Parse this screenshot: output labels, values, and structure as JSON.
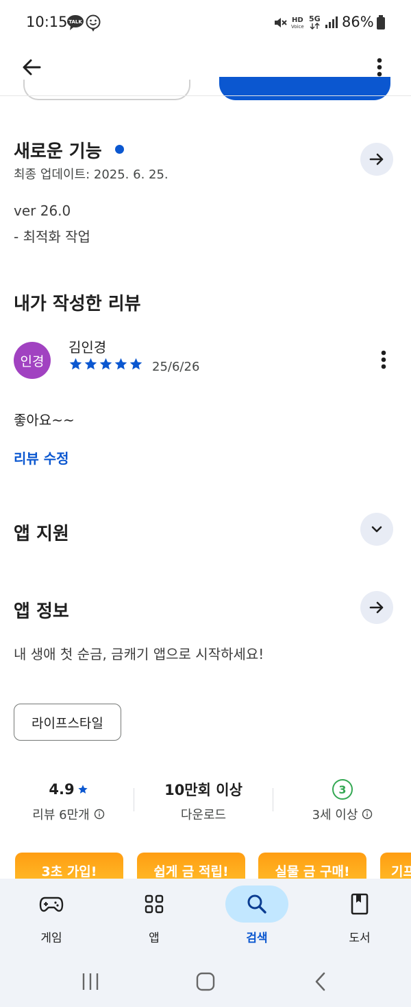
{
  "status_bar": {
    "time": "10:15",
    "notification_icons": [
      "talk-icon",
      "smile-icon"
    ],
    "system_icons": [
      "mute-icon",
      "hd-voice-icon",
      "5g-icon",
      "signal-icon"
    ],
    "hd_text": "HD",
    "voice_text": "Voice",
    "net_text": "5G",
    "battery_percent": "86%",
    "battery_level": 0.86
  },
  "toolbar": {
    "back_icon": "arrow-back-icon",
    "more_icon": "more-vert-icon"
  },
  "whats_new": {
    "title": "새로운 기능",
    "updated": "최종 업데이트: 2025. 6. 25.",
    "version": "ver 26.0",
    "notes": "- 최적화 작업"
  },
  "my_review": {
    "title": "내가 작성한 리뷰",
    "avatar_text": "인경",
    "reviewer_name": "김인경",
    "rating": 5,
    "date": "25/6/26",
    "text": "좋아요~~",
    "edit_label": "리뷰 수정"
  },
  "app_support": {
    "title": "앱 지원"
  },
  "about_app": {
    "title": "앱 정보",
    "description": "내 생애 첫 순금, 금캐기 앱으로 시작하세요!",
    "category_chip": "라이프스타일"
  },
  "stats": {
    "rating": "4.9",
    "reviews_label": "리뷰 6만개",
    "downloads": "10만회 이상",
    "downloads_label": "다운로드",
    "age_rating": "3",
    "age_label": "3세 이상"
  },
  "promos": [
    "3초 가입!",
    "쉽게 금 적립!",
    "실물 금 구매!",
    "기프"
  ],
  "bottom_nav": [
    {
      "label": "게임",
      "icon": "gamepad-icon",
      "active": false
    },
    {
      "label": "앱",
      "icon": "apps-grid-icon",
      "active": false
    },
    {
      "label": "검색",
      "icon": "search-icon",
      "active": true
    },
    {
      "label": "도서",
      "icon": "book-icon",
      "active": false
    }
  ],
  "system_nav": {
    "recents_icon": "recents-icon",
    "home_icon": "home-icon",
    "back_icon": "back-chevron-icon"
  },
  "colors": {
    "accent": "#0b57d0",
    "avatar": "#a142c1",
    "age_badge": "#34a853",
    "promo": "#ffa51a",
    "nav_bg": "#f0f3f8",
    "nav_active": "#c2e7ff"
  }
}
